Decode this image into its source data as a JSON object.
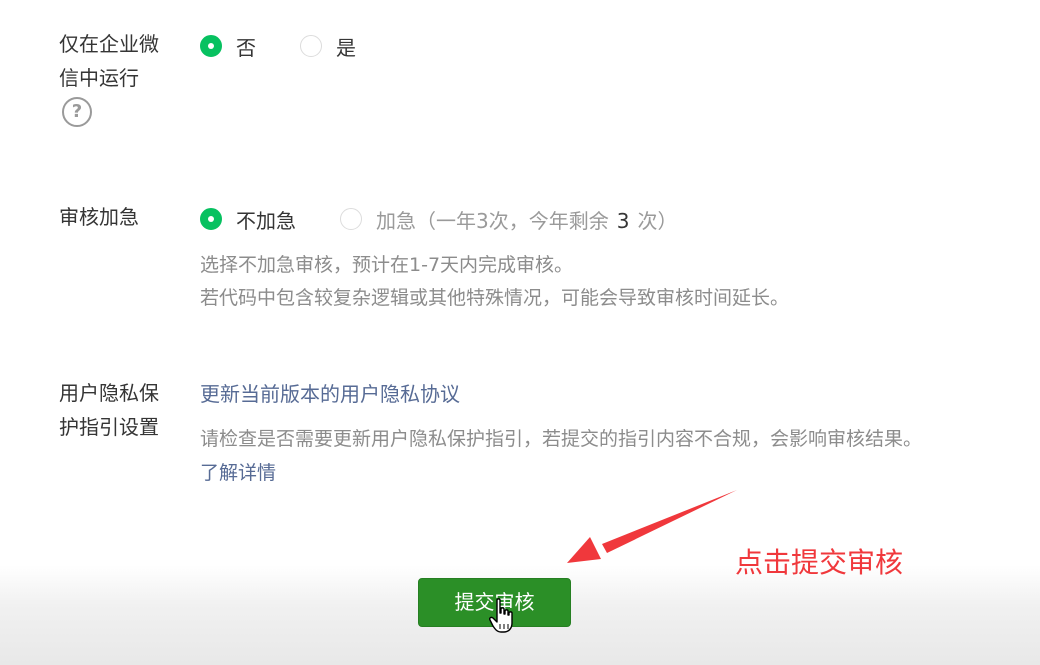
{
  "run_in_wecom": {
    "label": "仅在企业微信中运行",
    "help_icon_symbol": "?",
    "options": [
      {
        "label": "否",
        "checked": true
      },
      {
        "label": "是",
        "checked": false
      }
    ]
  },
  "expedite_review": {
    "label": "审核加急",
    "options": [
      {
        "label": "不加急",
        "checked": true
      },
      {
        "label": "加急",
        "checked": false
      }
    ],
    "quota_prefix": "（一年3次，今年剩余",
    "quota_remaining": "3",
    "quota_suffix": "次）",
    "description_line1": "选择不加急审核，预计在1-7天内完成审核。",
    "description_line2": "若代码中包含较复杂逻辑或其他特殊情况，可能会导致审核时间延长。"
  },
  "privacy_guide": {
    "label": "用户隐私保护指引设置",
    "update_link": "更新当前版本的用户隐私协议",
    "description": "请检查是否需要更新用户隐私保护指引，若提交的指引内容不合规，会影响审核结果。",
    "learn_more_link": "了解详情"
  },
  "submit_button": {
    "label": "提交审核"
  },
  "annotation": {
    "text": "点击提交审核",
    "color": "#f0383c"
  },
  "colors": {
    "accent_green": "#07c160",
    "button_green": "#2b8f27",
    "link_blue": "#576b95"
  }
}
